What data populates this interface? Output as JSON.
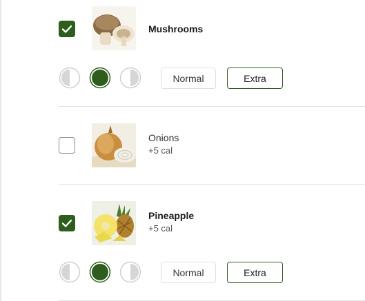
{
  "items": [
    {
      "name": "Mushrooms",
      "calories": "",
      "checked": true,
      "normal_label": "Normal",
      "extra_label": "Extra"
    },
    {
      "name": "Onions",
      "calories": "+5 cal",
      "checked": false
    },
    {
      "name": "Pineapple",
      "calories": "+5 cal",
      "checked": true,
      "normal_label": "Normal",
      "extra_label": "Extra"
    }
  ],
  "colors": {
    "accent": "#2f5d1e",
    "portion_gray": "#d6d6d6"
  },
  "icons": {
    "checked": "checkmark-icon",
    "portion_left": "half-left-portion-icon",
    "portion_whole": "whole-portion-icon",
    "portion_right": "half-right-portion-icon"
  }
}
